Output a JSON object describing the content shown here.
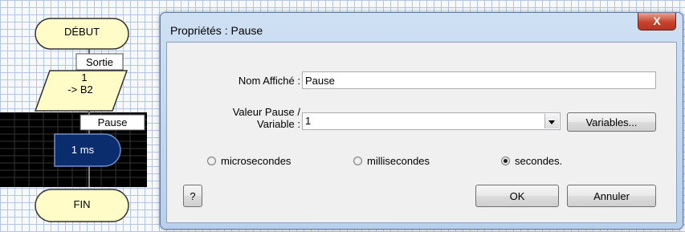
{
  "flowchart": {
    "start_label": "DÉBUT",
    "output_tag": "Sortie",
    "output_line1": "1",
    "output_line2": "-> B2",
    "pause_tag": "Pause",
    "pause_value": "1 ms",
    "end_label": "FIN"
  },
  "dialog": {
    "title": "Propriétés : Pause",
    "close_glyph": "X",
    "display_name_label": "Nom Affiché :",
    "display_name_value": "Pause",
    "pause_value_label_line1": "Valeur Pause /",
    "pause_value_label_line2": "Variable :",
    "pause_value": "1",
    "variables_button": "Variables...",
    "units": [
      {
        "label": "microsecondes",
        "selected": false
      },
      {
        "label": "millisecondes",
        "selected": false
      },
      {
        "label": "secondes.",
        "selected": true
      }
    ],
    "help_button": "?",
    "ok_button": "OK",
    "cancel_button": "Annuler"
  },
  "colors": {
    "pause_block": "#0b2d6e",
    "pause_background": "#000000",
    "start_end_fill": "#fffcc8",
    "output_fill": "#fffcc8"
  }
}
